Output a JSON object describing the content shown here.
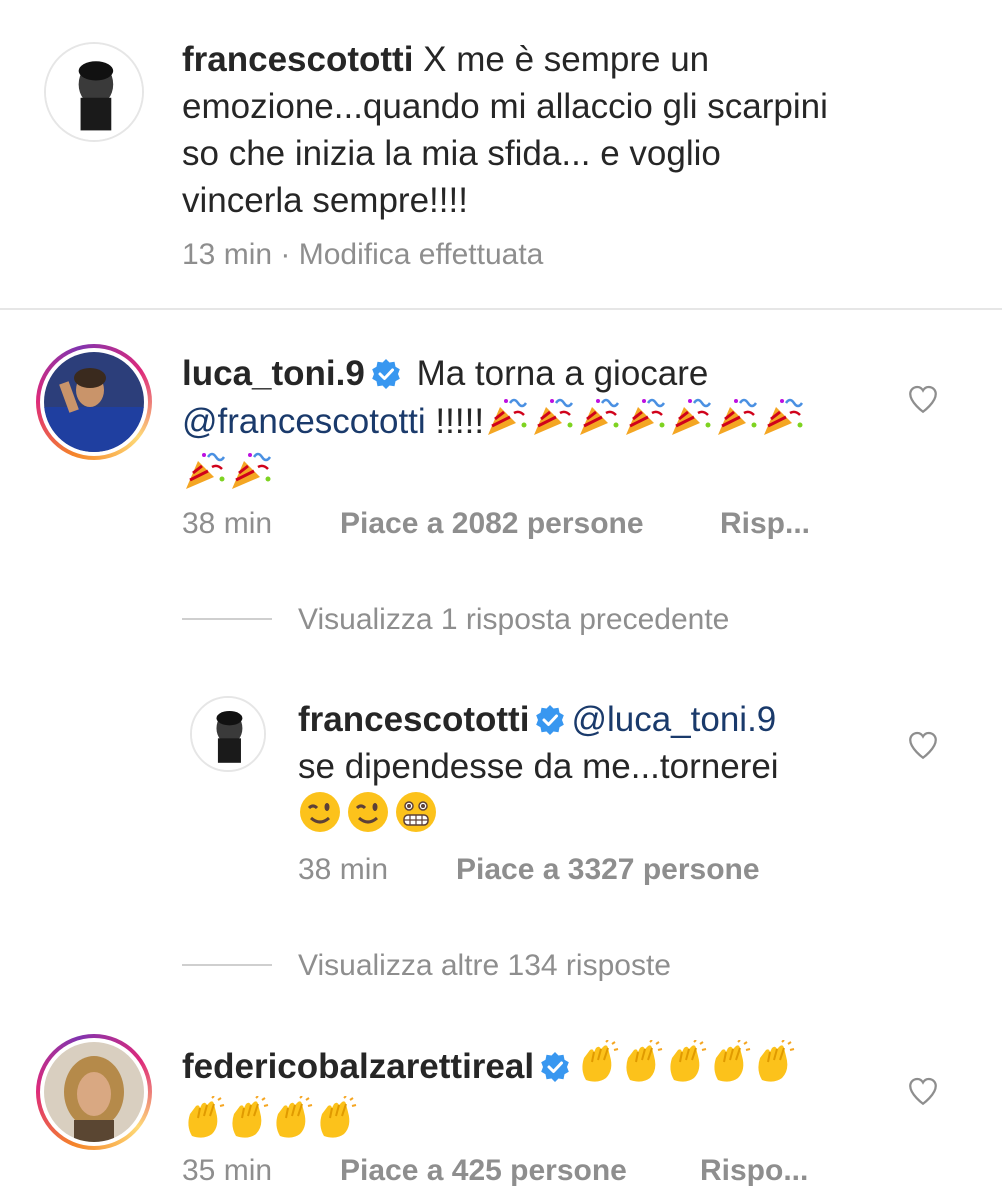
{
  "caption": {
    "username": "francescototti",
    "text_line1": "X me è sempre un",
    "text_line2": "emozione...quando mi allaccio gli scarpini",
    "text_line3": "so che inizia la mia sfida... e voglio",
    "text_line4": "vincerla sempre!!!!",
    "time": "13 min",
    "separator": "·",
    "edited": "Modifica effettuata"
  },
  "comment1": {
    "username": "luca_toni.9",
    "text": "Ma torna a giocare",
    "mention": "@francescototti",
    "exclaim": "!!!!!",
    "emoji_name": "party-popper",
    "emoji_count_line1": 7,
    "emoji_count_line2": 2,
    "time": "38 min",
    "likes": "Piace a 2082 persone",
    "reply": "Risp..."
  },
  "view_previous": "Visualizza 1 risposta precedente",
  "reply1": {
    "username": "francescototti",
    "mention": "@luca_toni.9",
    "text": "se dipendesse da me...tornerei",
    "emojis": [
      "winking-face",
      "winking-face",
      "grimacing-face"
    ],
    "time": "38 min",
    "likes": "Piace a 3327 persone"
  },
  "view_more": "Visualizza altre 134 risposte",
  "comment2": {
    "username": "federicobalzarettireal",
    "emoji_name": "clapping-hands",
    "emoji_count_line1": 5,
    "emoji_count_line2": 4,
    "time": "35 min",
    "likes": "Piace a 425 persone",
    "reply": "Rispo..."
  },
  "colors": {
    "verified": "#3897f0",
    "text": "#262626",
    "meta": "#8e8e8e",
    "mention": "#1a3a6b"
  }
}
